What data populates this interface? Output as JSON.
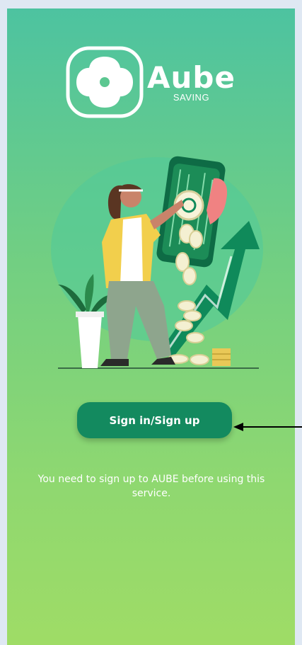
{
  "brand": {
    "name": "Aube",
    "subtitle": "SAVING"
  },
  "actions": {
    "signin_label": "Sign in/Sign up"
  },
  "notice": {
    "text": "You need to sign up to AUBE before using this service."
  },
  "colors": {
    "gradient_top": "#4dc3a0",
    "gradient_bottom": "#9fdc66",
    "button": "#138a5f",
    "text": "#ffffff"
  },
  "icons": {
    "logo": "aube-logo-icon",
    "annotation": "arrow-left-icon"
  }
}
